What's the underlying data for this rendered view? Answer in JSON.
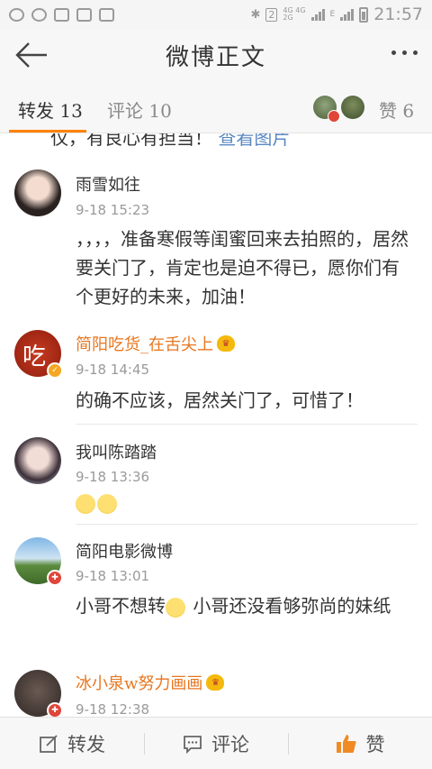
{
  "status_bar": {
    "time": "21:57",
    "badge": "2",
    "net_top": "4G 4G",
    "net_bottom": "2G",
    "e_label": "E"
  },
  "header": {
    "title": "微博正文"
  },
  "tabs": {
    "repost_label": "转发",
    "repost_count": "13",
    "comment_label": "评论",
    "comment_count": "10",
    "like_label": "赞",
    "like_count": "6"
  },
  "partial_comment": {
    "text": "仅，有良心有担当！",
    "link": "查看图片"
  },
  "comments": [
    {
      "name": "雨雪如往",
      "time": "9-18 15:23",
      "text": "，，，，准备寒假等闺蜜回来去拍照的，居然要关门了，肯定也是迫不得已，愿你们有个更好的未来，加油！"
    },
    {
      "name": "简阳吃货_在舌尖上",
      "time": "9-18 14:45",
      "text": "的确不应该，居然关门了，可惜了！"
    },
    {
      "name": "我叫陈踏踏",
      "time": "9-18 13:36",
      "text": ""
    },
    {
      "name": "简阳电影微博",
      "time": "9-18 13:01",
      "text_a": "小哥不想转",
      "text_b": "小哥还没看够弥尚的妹纸"
    },
    {
      "name": "冰小泉w努力画画",
      "time": "9-18 12:38"
    }
  ],
  "avatar_glyph": "吃",
  "bottom_bar": {
    "repost": "转发",
    "comment": "评论",
    "like": "赞"
  },
  "colors": {
    "accent": "#ff8200",
    "vip_name": "#e8761f",
    "link": "#5b88c2"
  }
}
